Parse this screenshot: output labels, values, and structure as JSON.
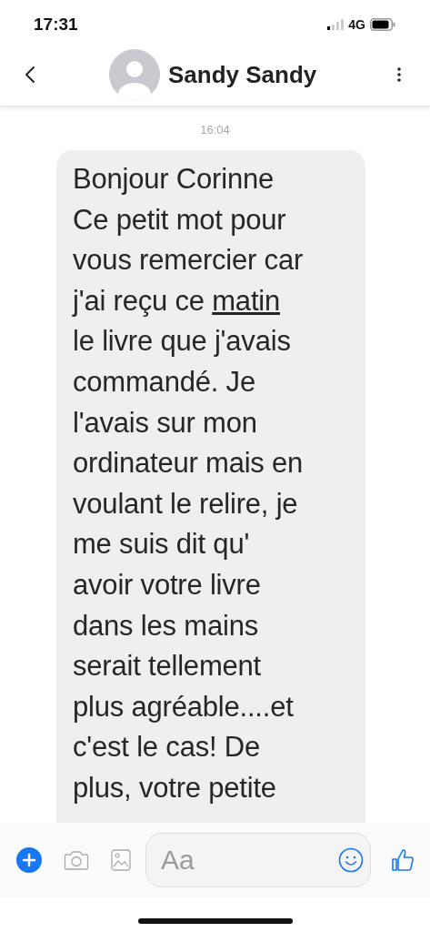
{
  "status_bar": {
    "time": "17:31",
    "network": "4G"
  },
  "header": {
    "contact_name": "Sandy Sandy"
  },
  "conversation": {
    "timestamp": "16:04",
    "message_lines": [
      [
        {
          "text": "Bonjour Corinne"
        }
      ],
      [
        {
          "text": "Ce petit mot pour"
        }
      ],
      [
        {
          "text": "vous remercier car"
        }
      ],
      [
        {
          "text": "j'ai reçu ce "
        },
        {
          "text": "matin",
          "link": true
        }
      ],
      [
        {
          "text": "le livre que j'avais"
        }
      ],
      [
        {
          "text": "commandé. Je"
        }
      ],
      [
        {
          "text": "l'avais sur mon"
        }
      ],
      [
        {
          "text": "ordinateur mais en"
        }
      ],
      [
        {
          "text": "voulant le relire, je"
        }
      ],
      [
        {
          "text": "me suis dit qu'"
        }
      ],
      [
        {
          "text": "avoir votre livre"
        }
      ],
      [
        {
          "text": "dans les mains"
        }
      ],
      [
        {
          "text": "serait tellement"
        }
      ],
      [
        {
          "text": "plus agréable....et"
        }
      ],
      [
        {
          "text": "c'est le cas! De"
        }
      ],
      [
        {
          "text": "plus, votre petite"
        }
      ]
    ]
  },
  "composer": {
    "placeholder": "Aa"
  }
}
